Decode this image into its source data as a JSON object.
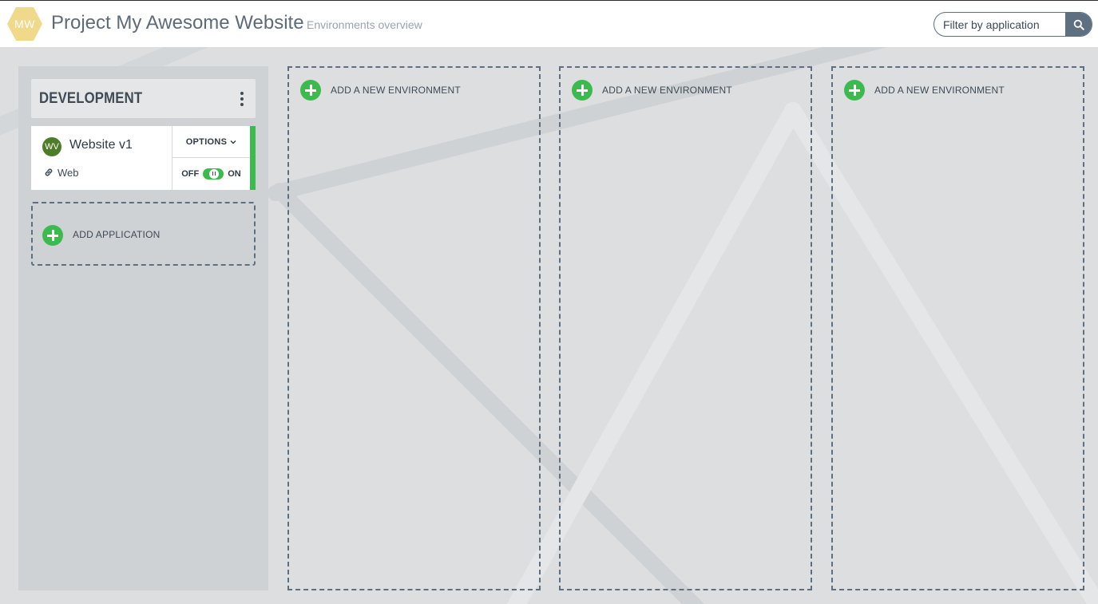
{
  "header": {
    "logo_initials": "MW",
    "project_title": "Project My Awesome Website",
    "subtitle": "Environments overview",
    "filter_placeholder": "Filter by application"
  },
  "environments": [
    {
      "name": "DEVELOPMENT",
      "applications": [
        {
          "initials": "WV",
          "name": "Website v1",
          "type": "Web",
          "options_label": "OPTIONS",
          "toggle_off_label": "OFF",
          "toggle_on_label": "ON",
          "enabled": true
        }
      ],
      "add_application_label": "ADD APPLICATION"
    }
  ],
  "new_environment_slots": [
    {
      "label": "ADD A NEW ENVIRONMENT"
    },
    {
      "label": "ADD A NEW ENVIRONMENT"
    },
    {
      "label": "ADD A NEW ENVIRONMENT"
    }
  ],
  "colors": {
    "accent_green": "#3dba4e",
    "logo_hex": "#f1d98c",
    "slate": "#5d6f80",
    "avatar_green": "#4e7d2a"
  },
  "icons": {
    "search": "search-icon",
    "link": "link-icon",
    "kebab": "kebab-menu-icon",
    "chevron": "chevron-down-icon",
    "plus": "plus-circle-icon"
  }
}
